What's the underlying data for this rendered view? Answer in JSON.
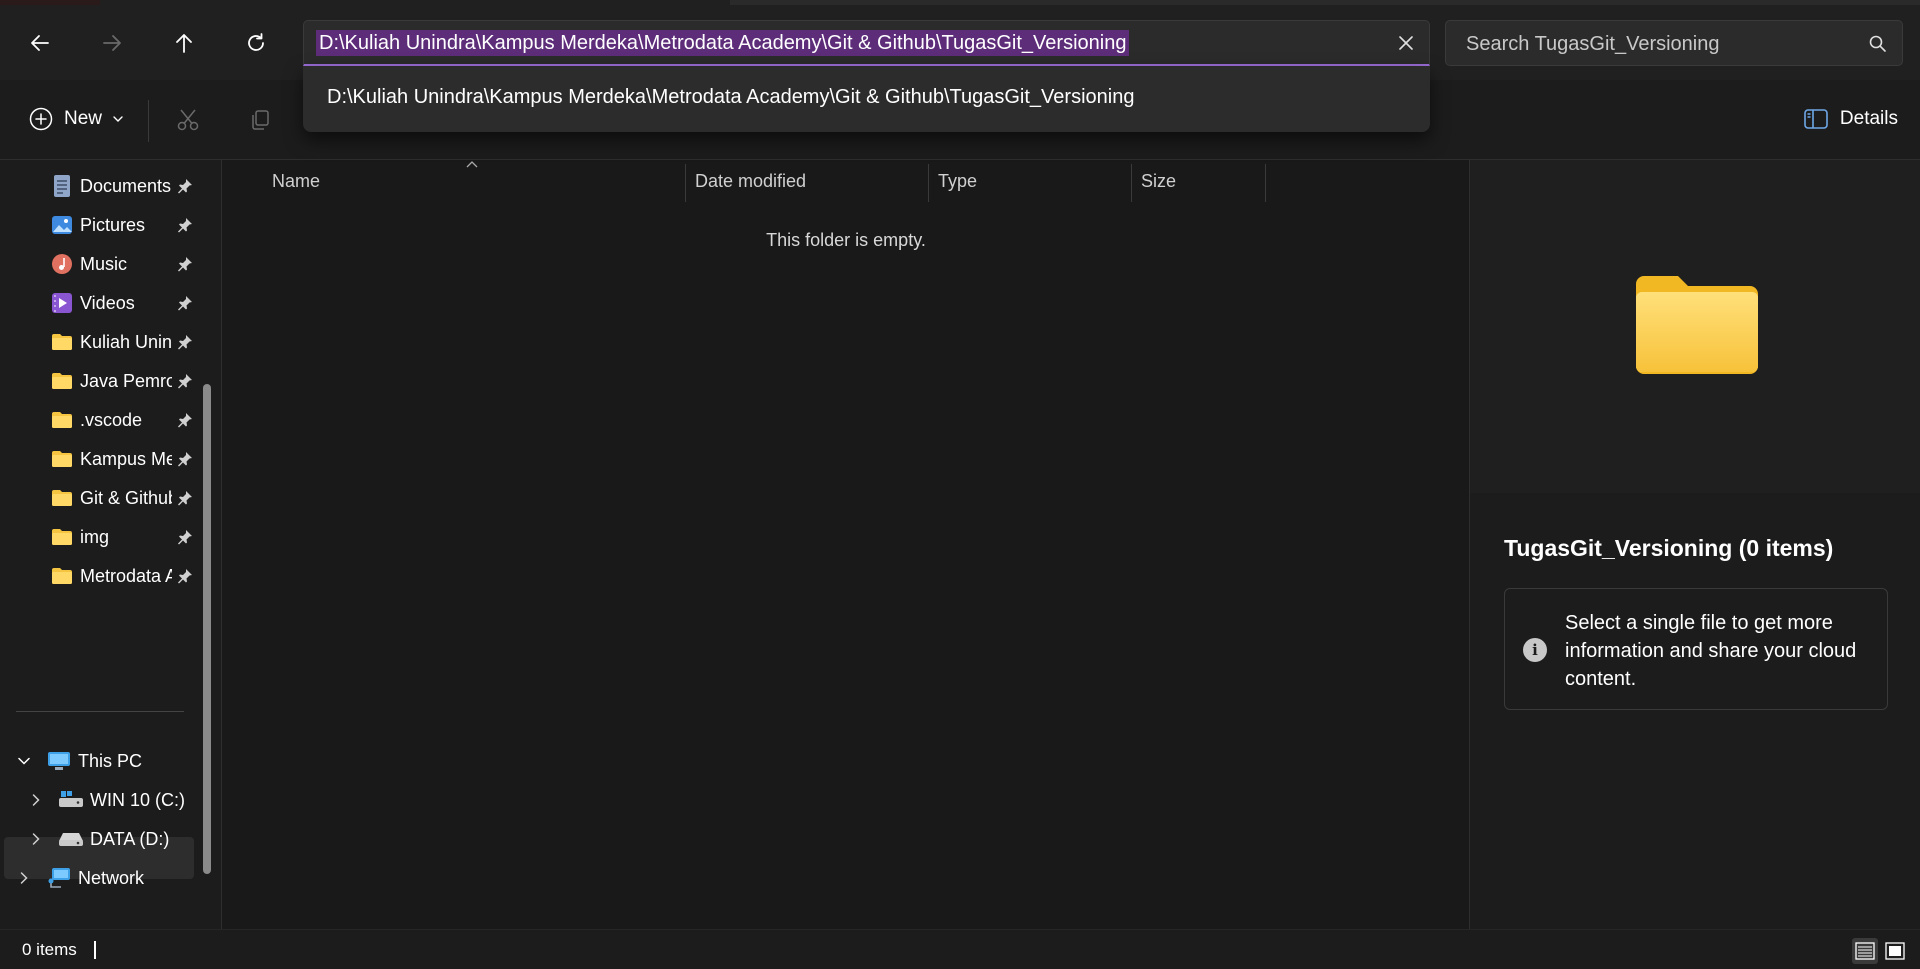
{
  "address_bar": {
    "path": "D:\\Kuliah Unindra\\Kampus Merdeka\\Metrodata Academy\\Git & Github\\TugasGit_Versioning",
    "suggestion": "D:\\Kuliah Unindra\\Kampus Merdeka\\Metrodata Academy\\Git & Github\\TugasGit_Versioning"
  },
  "search": {
    "placeholder": "Search TugasGit_Versioning"
  },
  "command_bar": {
    "new_label": "New",
    "details_label": "Details"
  },
  "sidebar": {
    "quick_access": [
      {
        "label": "Documents",
        "icon": "documents-icon"
      },
      {
        "label": "Pictures",
        "icon": "pictures-icon"
      },
      {
        "label": "Music",
        "icon": "music-icon"
      },
      {
        "label": "Videos",
        "icon": "videos-icon"
      },
      {
        "label": "Kuliah Unindra",
        "icon": "folder-icon"
      },
      {
        "label": "Java Pemrograman",
        "icon": "folder-icon"
      },
      {
        "label": ".vscode",
        "icon": "folder-icon"
      },
      {
        "label": "Kampus Merdeka",
        "icon": "folder-icon"
      },
      {
        "label": "Git & Github",
        "icon": "folder-icon"
      },
      {
        "label": "img",
        "icon": "folder-icon"
      },
      {
        "label": "Metrodata Academy",
        "icon": "folder-icon"
      }
    ],
    "this_pc": "This PC",
    "drives": [
      {
        "label": "WIN 10 (C:)"
      },
      {
        "label": "DATA (D:)"
      }
    ],
    "network": "Network"
  },
  "file_list": {
    "columns": [
      "Name",
      "Date modified",
      "Type",
      "Size"
    ],
    "empty_message": "This folder is empty."
  },
  "details_pane": {
    "title": "TugasGit_Versioning (0 items)",
    "info": "Select a single file to get more information and share your cloud content."
  },
  "status_bar": {
    "item_count": "0 items"
  },
  "colors": {
    "accent": "#9b6dd8",
    "selection": "#5d2d7a",
    "folder": "#f5c542"
  }
}
